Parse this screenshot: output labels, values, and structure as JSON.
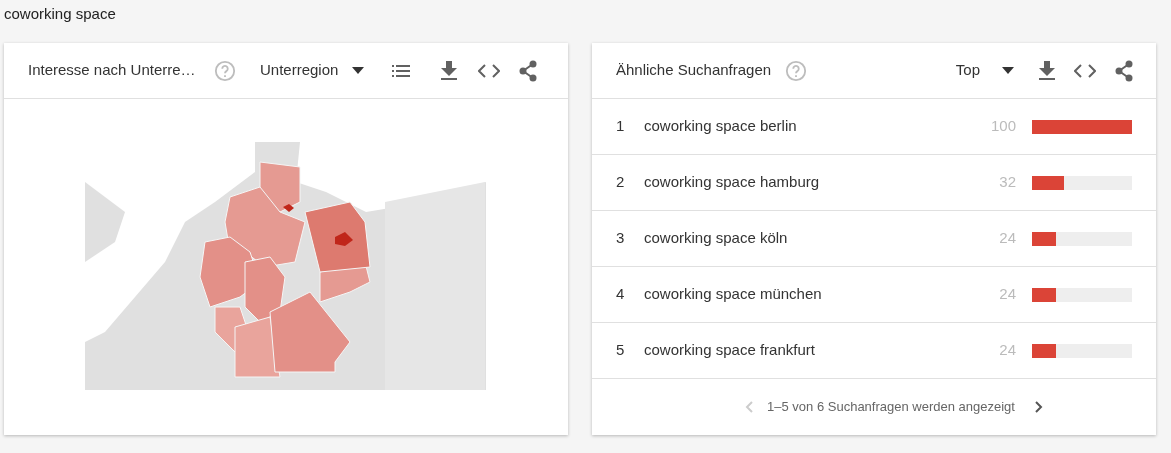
{
  "search_term": "coworking space",
  "region_card": {
    "title": "Interesse nach Unterre…",
    "dropdown": "Unterregion"
  },
  "related_card": {
    "title": "Ähnliche Suchanfragen",
    "dropdown": "Top",
    "rows": [
      {
        "rank": "1",
        "query": "coworking space berlin",
        "value": "100",
        "level": 1.0
      },
      {
        "rank": "2",
        "query": "coworking space hamburg",
        "value": "32",
        "level": 0.32
      },
      {
        "rank": "3",
        "query": "coworking space köln",
        "value": "24",
        "level": 0.24
      },
      {
        "rank": "4",
        "query": "coworking space münchen",
        "value": "24",
        "level": 0.24
      },
      {
        "rank": "5",
        "query": "coworking space frankfurt",
        "value": "24",
        "level": 0.24
      }
    ],
    "pagination": {
      "text": "1–5 von 6 Suchanfragen werden angezeigt",
      "prev_disabled": true,
      "next_disabled": false
    }
  }
}
